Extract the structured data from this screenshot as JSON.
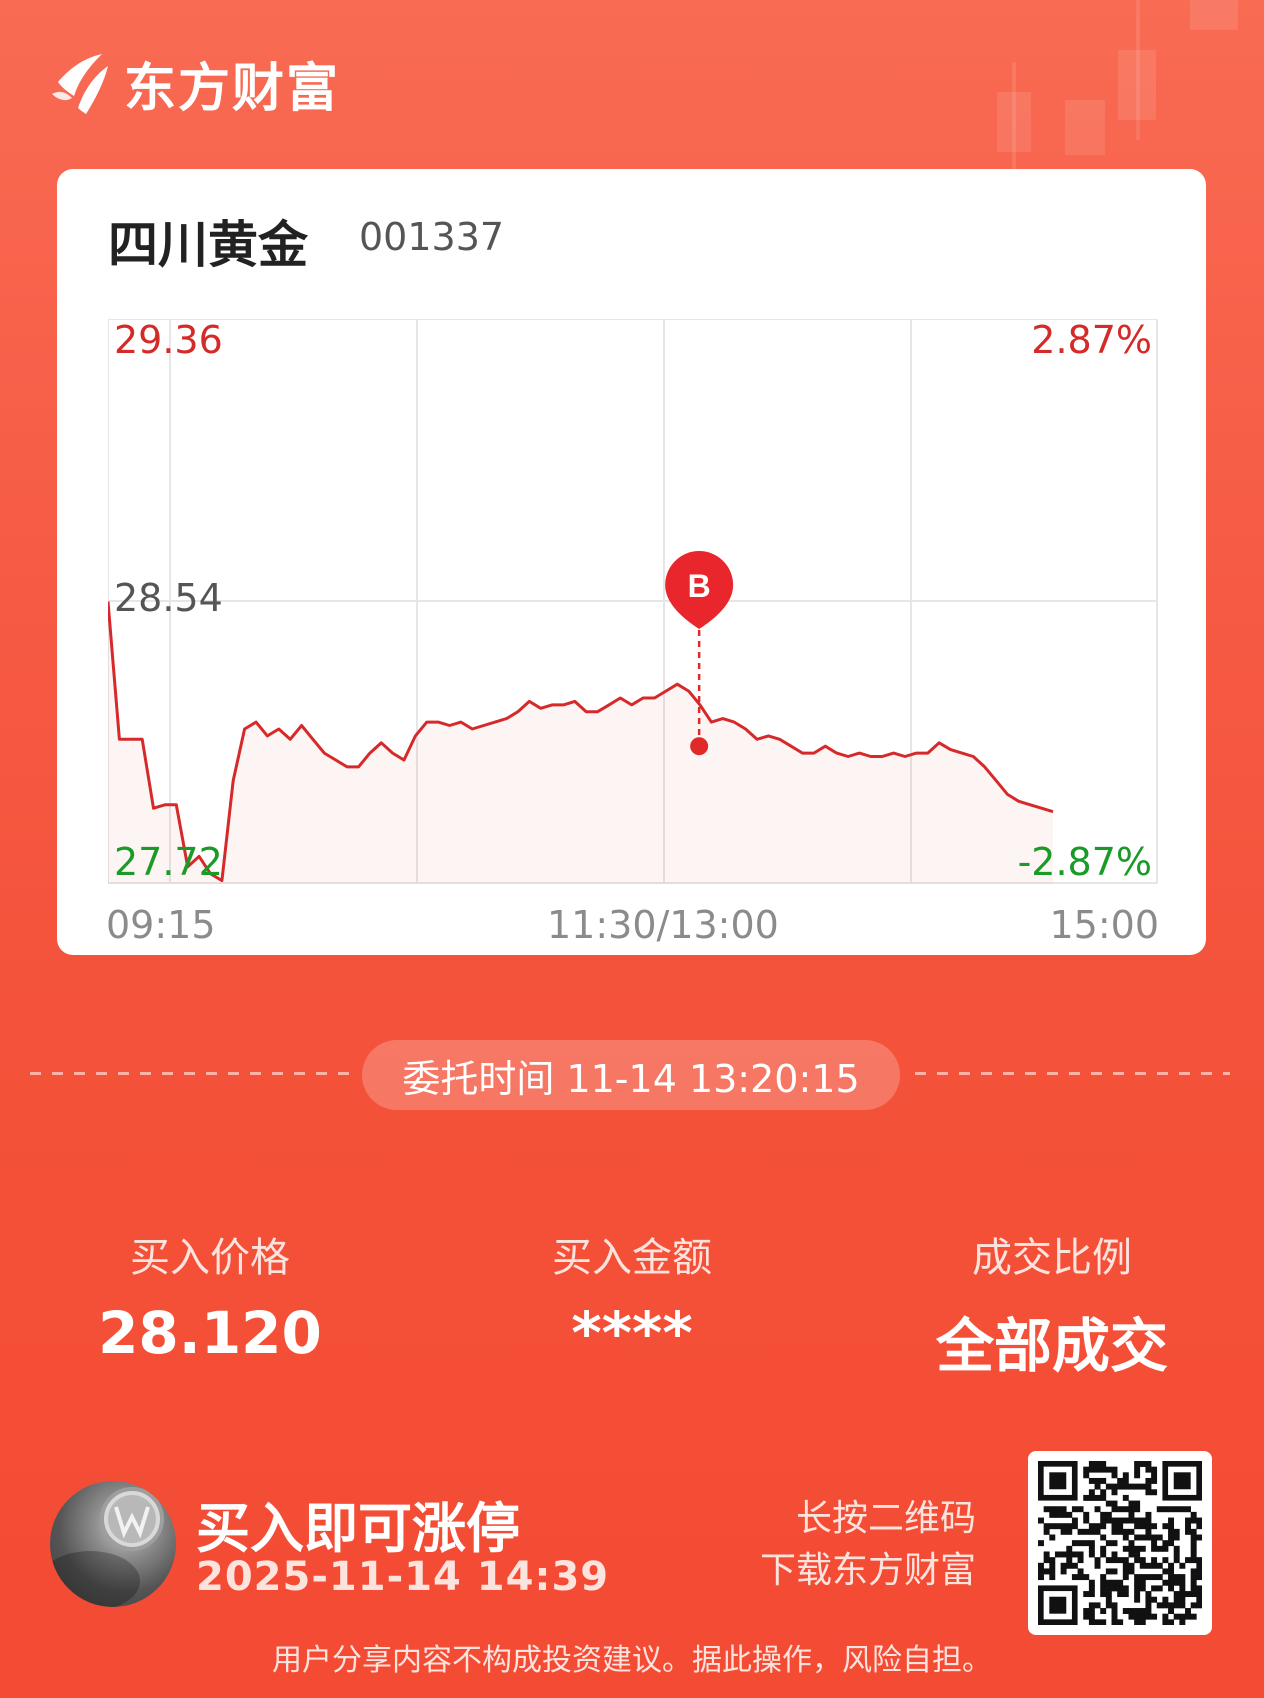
{
  "brand": {
    "name": "东方财富"
  },
  "stock": {
    "name": "四川黄金",
    "code": "001337"
  },
  "chart": {
    "price_high": "29.36",
    "price_mid": "28.54",
    "price_low": "27.72",
    "pct_high": "2.87%",
    "pct_low": "-2.87%",
    "x_start": "09:15",
    "x_mid": "11:30/13:00",
    "x_end": "15:00",
    "marker_label": "B",
    "colors": {
      "up": "#d42a28",
      "down": "#1a9a26",
      "line": "#d6292a"
    }
  },
  "chart_data": {
    "type": "line",
    "xlabel": "",
    "ylabel": "",
    "ylim": [
      27.72,
      29.36
    ],
    "x_ticks": [
      "09:15",
      "11:30/13:00",
      "15:00"
    ],
    "y_ticks": [
      "27.72",
      "28.54",
      "29.36"
    ],
    "pct_ticks": [
      "-2.87%",
      "2.87%"
    ],
    "series": [
      {
        "values": [
          28.54,
          28.14,
          28.14,
          28.14,
          27.94,
          27.95,
          27.95,
          27.77,
          27.8,
          27.75,
          27.73,
          28.02,
          28.17,
          28.19,
          28.15,
          28.17,
          28.14,
          28.18,
          28.14,
          28.1,
          28.08,
          28.06,
          28.06,
          28.1,
          28.13,
          28.1,
          28.08,
          28.15,
          28.19,
          28.19,
          28.18,
          28.19,
          28.17,
          28.18,
          28.19,
          28.2,
          28.22,
          28.25,
          28.23,
          28.24,
          28.24,
          28.25,
          28.22,
          28.22,
          28.24,
          28.26,
          28.24,
          28.26,
          28.26,
          28.28,
          28.3,
          28.28,
          28.24,
          28.19,
          28.2,
          28.19,
          28.17,
          28.14,
          28.15,
          28.14,
          28.12,
          28.1,
          28.1,
          28.12,
          28.1,
          28.09,
          28.1,
          28.09,
          28.09,
          28.1,
          28.09,
          28.1,
          28.1,
          28.13,
          28.11,
          28.1,
          28.09,
          28.06,
          28.02,
          27.98,
          27.96,
          27.95,
          27.94,
          27.93
        ]
      }
    ],
    "marker": {
      "label": "B",
      "time": "13:20",
      "value": 28.12
    }
  },
  "order": {
    "time_text": "委托时间 11-14 13:20:15"
  },
  "stats": [
    {
      "label": "买入价格",
      "value": "28.120"
    },
    {
      "label": "买入金额",
      "value": "****"
    },
    {
      "label": "成交比例",
      "value": "全部成交"
    }
  ],
  "promo": {
    "title": "买入即可涨停",
    "date": "2025-11-14 14:39"
  },
  "qr": {
    "line1": "长按二维码",
    "line2": "下载东方财富"
  },
  "disclaimer": "用户分享内容不构成投资建议。据此操作，风险自担。"
}
